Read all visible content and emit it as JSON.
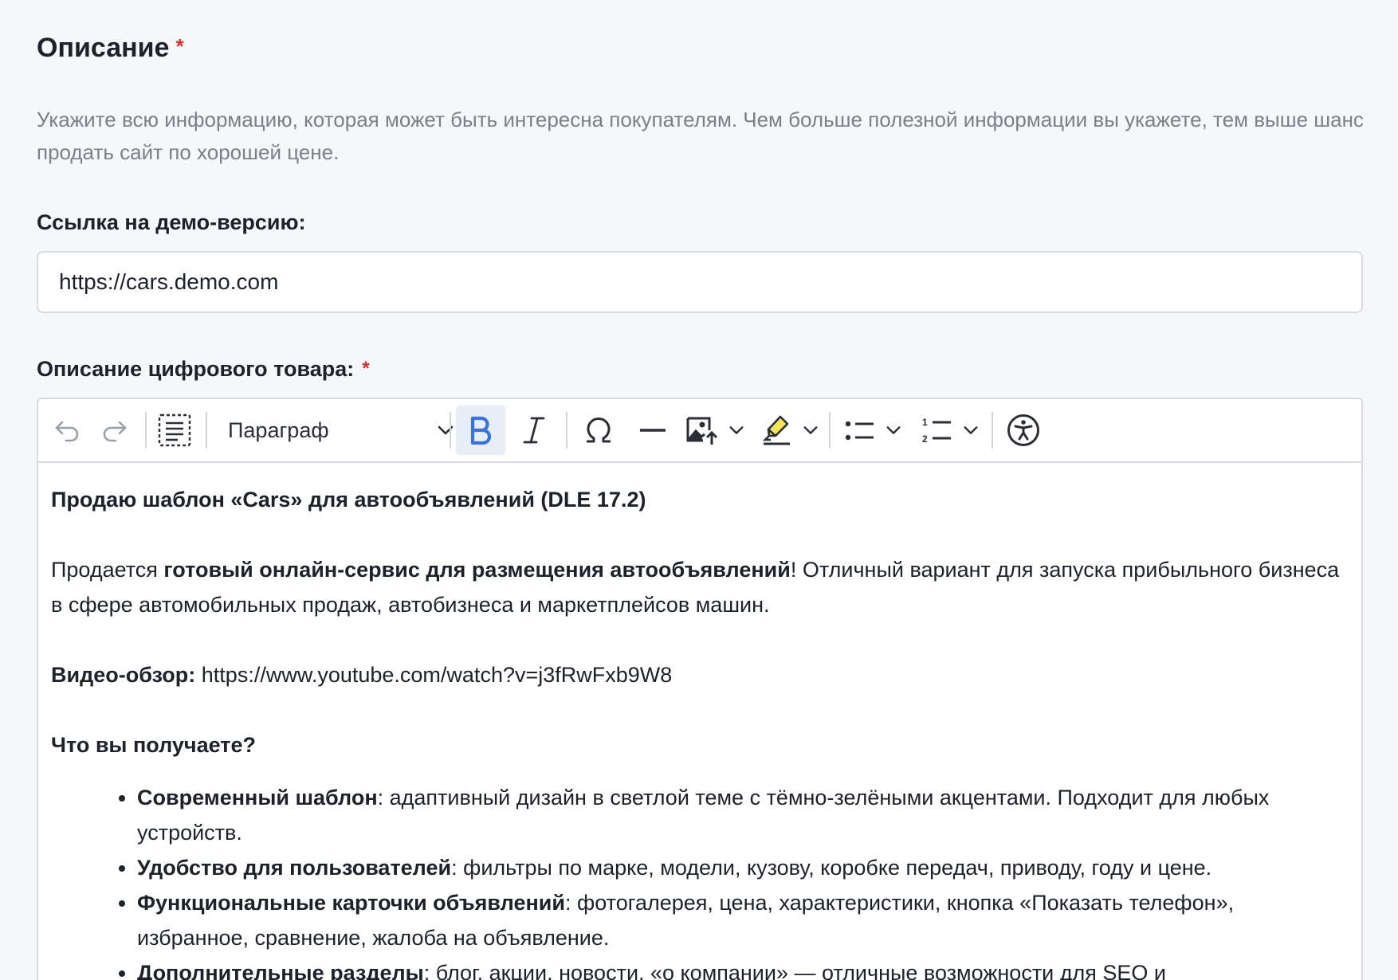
{
  "section": {
    "title": "Описание",
    "required_mark": "*",
    "hint": "Укажите всю информацию, которая может быть интересна покупателям. Чем больше полезной информации вы укажете, тем выше шанс продать сайт по хорошей цене."
  },
  "demo_field": {
    "label": "Ссылка на демо-версию:",
    "value": "https://cars.demo.com"
  },
  "description_field": {
    "label": "Описание цифрового товара:",
    "required_mark": "*"
  },
  "toolbar": {
    "heading_value": "Параграф",
    "buttons": {
      "undo": "undo-icon",
      "redo": "redo-icon",
      "select_all": "select-all-icon",
      "bold": "bold-icon",
      "italic": "italic-icon",
      "special_chars": "omega-icon",
      "horizontal_line": "horizontal-line-icon",
      "insert_image": "image-upload-icon",
      "highlight": "highlighter-icon",
      "bulleted_list": "bulleted-list-icon",
      "numbered_list": "numbered-list-icon",
      "accessibility": "accessibility-icon"
    },
    "active_color": "#3b73d6"
  },
  "content": {
    "heading": "Продаю шаблон «Cars» для автообъявлений (DLE 17.2)",
    "intro_prefix": "Продается ",
    "intro_bold": "готовый онлайн-сервис для размещения автообъявлений",
    "intro_suffix": "! Отличный вариант для запуска прибыльного бизнеса в сфере автомобильных продаж, автобизнеса и маркетплейсов машин.",
    "video_label": "Видео-обзор:",
    "video_url": " https://www.youtube.com/watch?v=j3fRwFxb9W8",
    "benefits_heading": "Что вы получаете?",
    "benefits": [
      {
        "title": "Современный шаблон",
        "text": ": адаптивный дизайн в светлой теме с тёмно-зелёными акцентами. Подходит для любых устройств."
      },
      {
        "title": "Удобство для пользователей",
        "text": ": фильтры по марке, модели, кузову, коробке передач, приводу, году и цене."
      },
      {
        "title": "Функциональные карточки объявлений",
        "text": ": фотогалерея, цена, характеристики, кнопка «Показать телефон», избранное, сравнение, жалоба на объявление."
      },
      {
        "title": "Дополнительные разделы",
        "text": ": блог, акции, новости, «о компании» — отличные возможности для SEO и"
      }
    ]
  }
}
